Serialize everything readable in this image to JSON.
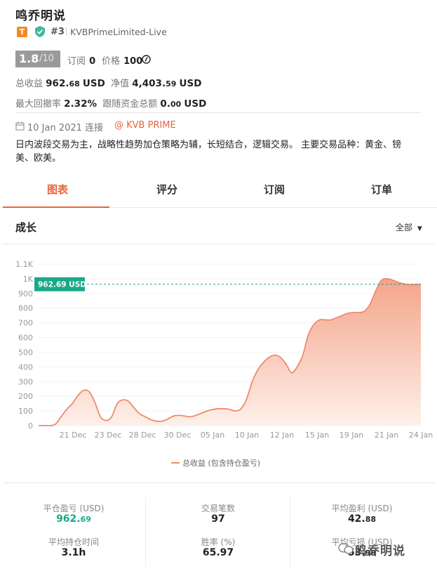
{
  "header": {
    "title": "鸣乔明说",
    "badge": "T",
    "rank": "#3",
    "account": "KVBPrimeLimited-Live"
  },
  "score": {
    "value": "1.8",
    "max": "/10"
  },
  "subscription": {
    "label": "订阅",
    "value": "0"
  },
  "price": {
    "label": "价格",
    "value": "100"
  },
  "metrics": {
    "total_profit_label": "总收益",
    "total_profit_main": "962.",
    "total_profit_dec": "68",
    "total_profit_unit": "USD",
    "net_value_label": "净值",
    "net_value_main": "4,403.",
    "net_value_dec": "59",
    "net_value_unit": "USD",
    "max_drawdown_label": "最大回撤率",
    "max_drawdown_value": "2.32%",
    "follow_total_label": "跟随资金总额",
    "follow_total_main": "0.",
    "follow_total_dec": "00",
    "follow_total_unit": "USD"
  },
  "connect": {
    "date": "10 Jan 2021 连接",
    "broker": "@ KVB PRIME"
  },
  "description": "日内波段交易为主，战略性趋势加仓策略为辅，长短结合，逻辑交易。 主要交易品种：黄金、镑美、欧美。",
  "tabs": [
    "图表",
    "评分",
    "订阅",
    "订单"
  ],
  "chart_section": {
    "title": "成长",
    "period": "全部"
  },
  "chart_data": {
    "type": "area",
    "ylim": [
      0,
      1100
    ],
    "yticks": [
      "0",
      "100",
      "200",
      "300",
      "400",
      "500",
      "600",
      "700",
      "800",
      "900",
      "1K",
      "1.1K"
    ],
    "xticks": [
      "21 Dec",
      "23 Dec",
      "28 Dec",
      "30 Dec",
      "05 Jan",
      "10 Jan",
      "12 Jan",
      "15 Jan",
      "19 Jan",
      "21 Jan",
      "24 Jan"
    ],
    "current_value_label": "962.69 USD",
    "current_value": 962.69,
    "series": [
      {
        "name": "总收益 (包含持仓盈亏)",
        "values": [
          0,
          0,
          0,
          10,
          60,
          110,
          150,
          205,
          240,
          230,
          160,
          60,
          35,
          60,
          150,
          175,
          165,
          120,
          80,
          60,
          40,
          30,
          30,
          45,
          65,
          70,
          65,
          60,
          70,
          85,
          100,
          110,
          115,
          115,
          110,
          100,
          115,
          180,
          300,
          380,
          430,
          465,
          480,
          465,
          420,
          360,
          400,
          480,
          620,
          690,
          720,
          720,
          720,
          735,
          750,
          765,
          770,
          770,
          780,
          830,
          920,
          990,
          1000,
          990,
          975,
          965,
          960,
          962,
          962.69
        ]
      }
    ],
    "legend": "总收益 (包含持仓盈亏)"
  },
  "stats": [
    {
      "label": "平仓盈亏 (USD)",
      "main": "962.",
      "dec": "69",
      "green": true
    },
    {
      "label": "交易笔数",
      "main": "97",
      "dec": ""
    },
    {
      "label": "平均盈利 (USD)",
      "main": "42.",
      "dec": "88"
    },
    {
      "label": "平均持仓时间",
      "main": "3.1h",
      "dec": ""
    },
    {
      "label": "胜率 (%)",
      "main": "65.97",
      "dec": ""
    },
    {
      "label": "平均亏损 (USD)",
      "main": "53.",
      "dec": "98"
    }
  ],
  "watermark": "鸣乔明说",
  "colors": {
    "accent": "#e8643a",
    "green": "#1aa88a",
    "area_top": "#f4a58a",
    "area_bottom": "#fdf0ea"
  }
}
